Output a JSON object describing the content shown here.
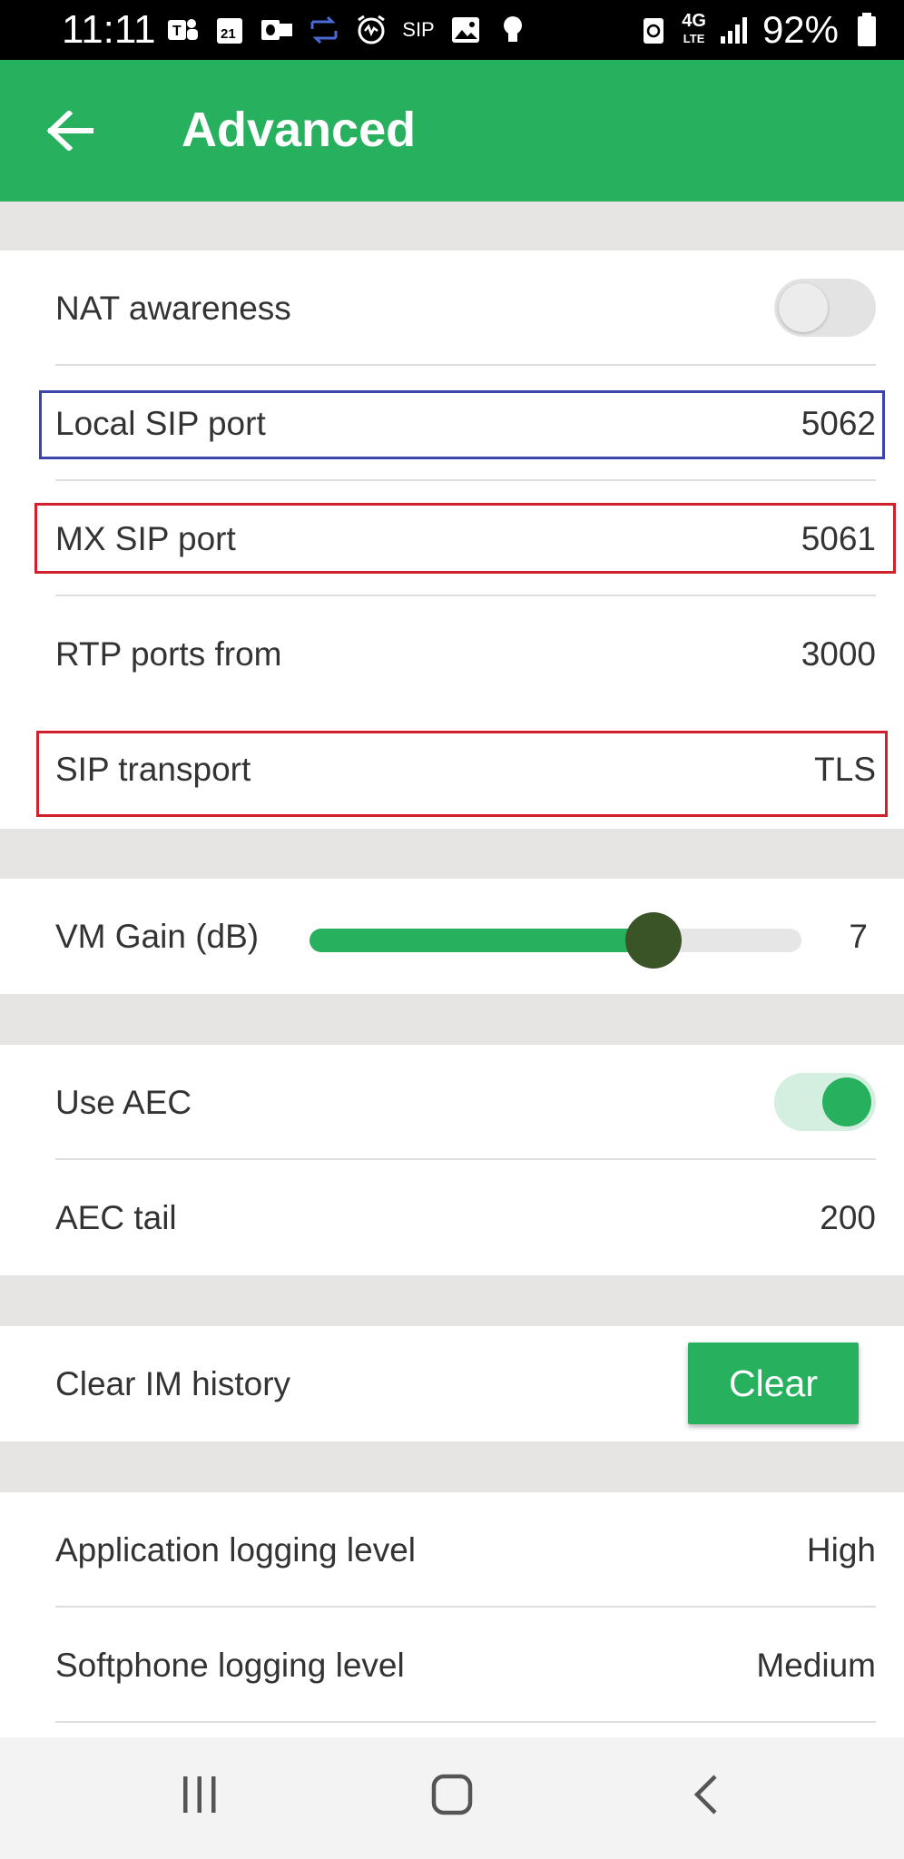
{
  "status_bar": {
    "time": "11:11",
    "icons": [
      "teams-icon",
      "calendar-icon",
      "outlook-icon",
      "sync-icon",
      "alarm-icon",
      "sip-icon",
      "image-icon",
      "bulb-icon"
    ],
    "sip_label": "SIP",
    "calendar_day": "21",
    "network": "4G",
    "network_sub": "LTE",
    "battery": "92%"
  },
  "app_bar": {
    "title": "Advanced",
    "back_icon": "arrow-back-icon"
  },
  "network_settings": {
    "nat_awareness": {
      "label": "NAT awareness",
      "enabled": false
    },
    "local_sip_port": {
      "label": "Local SIP port",
      "value": "5062"
    },
    "mx_sip_port": {
      "label": "MX SIP port",
      "value": "5061"
    },
    "rtp_ports_from": {
      "label": "RTP ports from",
      "value": "3000"
    },
    "sip_transport": {
      "label": "SIP transport",
      "value": "TLS"
    }
  },
  "audio": {
    "vm_gain": {
      "label": "VM Gain (dB)",
      "value": "7",
      "fraction": 0.7
    }
  },
  "aec": {
    "use_aec": {
      "label": "Use AEC",
      "enabled": true
    },
    "aec_tail": {
      "label": "AEC tail",
      "value": "200"
    }
  },
  "im": {
    "label": "Clear IM history",
    "button_label": "Clear"
  },
  "logging": {
    "application": {
      "label": "Application logging level",
      "value": "High"
    },
    "softphone": {
      "label": "Softphone logging level",
      "value": "Medium"
    }
  },
  "highlight_colors": {
    "blue": "#3c44a8",
    "red": "#d0202c"
  },
  "accent_color": "#27b05d",
  "nav_bar": {
    "icons": [
      "recent-apps-icon",
      "home-icon",
      "back-nav-icon"
    ]
  }
}
